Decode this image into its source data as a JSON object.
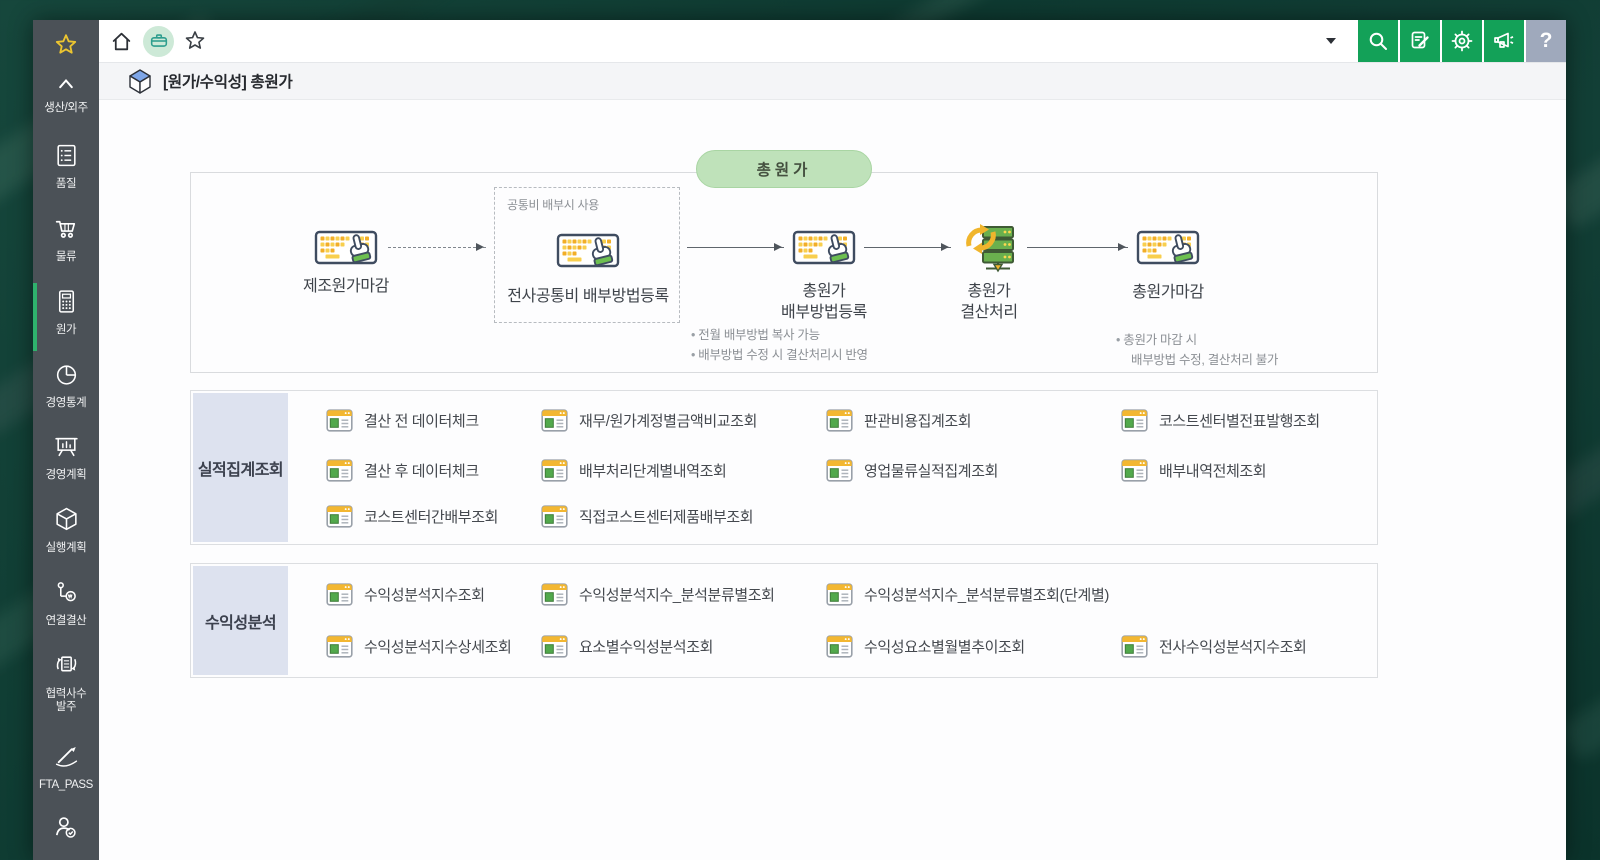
{
  "topbar": {
    "help": "?"
  },
  "title": {
    "text": "[원가/수익성] 총원가"
  },
  "sidebar": {
    "items": [
      {
        "label": "생산/외주"
      },
      {
        "label": "품질"
      },
      {
        "label": "물류"
      },
      {
        "label": "원가"
      },
      {
        "label": "경영통계"
      },
      {
        "label": "경영계획"
      },
      {
        "label": "실행계획"
      },
      {
        "label": "연결결산"
      },
      {
        "label": "협력사수",
        "label2": "발주"
      },
      {
        "label": "FTA_PASS"
      }
    ]
  },
  "flow": {
    "pill": "총원가",
    "box_note": "공통비 배부시 사용",
    "steps": [
      {
        "label": "제조원가마감"
      },
      {
        "label": "전사공통비 배부방법등록"
      },
      {
        "label": "총원가",
        "label2": "배부방법등록"
      },
      {
        "label": "총원가",
        "label2": "결산처리"
      },
      {
        "label": "총원가마감"
      }
    ],
    "notes_step3": [
      "전월 배부방법 복사 가능",
      "배부방법 수정 시 결산처리시 반영"
    ],
    "notes_step5": [
      "총원가 마감 시",
      "배부방법 수정, 결산처리 불가"
    ]
  },
  "sections": [
    {
      "title": "실적집계조회",
      "rows": [
        [
          "결산 전 데이터체크",
          "재무/원가계정별금액비교조회",
          "판관비용집계조회",
          "코스트센터별전표발행조회"
        ],
        [
          "결산 후 데이터체크",
          "배부처리단계별내역조회",
          "영업물류실적집계조회",
          "배부내역전체조회"
        ],
        [
          "코스트센터간배부조회",
          "직접코스트센터제품배부조회"
        ]
      ]
    },
    {
      "title": "수익성분석",
      "rows": [
        [
          "수익성분석지수조회",
          "수익성분석지수_분석분류별조회",
          "수익성분석지수_분석분류별조회(단계별)"
        ],
        [
          "수익성분석지수상세조회",
          "요소별수익성분석조회",
          "수익성요소별월별추이조회",
          "전사수익성분석지수조회"
        ]
      ]
    }
  ],
  "colors": {
    "accent_green": "#13a158",
    "sidebar": "#4b5157",
    "pill": "#bfe2ba",
    "section_label": "#dde2ef"
  }
}
